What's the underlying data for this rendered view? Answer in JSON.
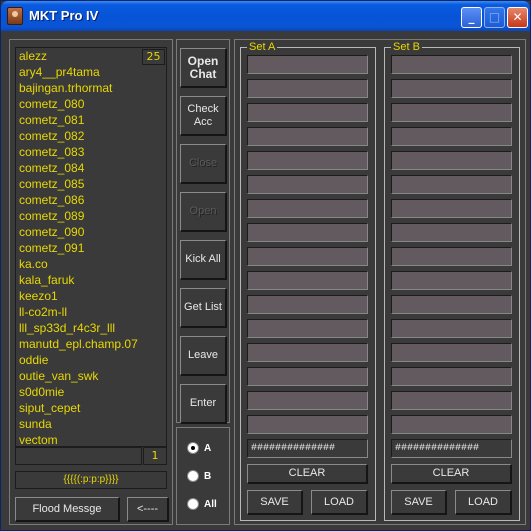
{
  "window": {
    "title": "MKT Pro IV",
    "controls": {
      "minimize": "_",
      "maximize": "□",
      "close": "✕"
    }
  },
  "users": {
    "count": "25",
    "items": [
      "alezz",
      "ary4__pr4tama",
      "bajingan.trhormat",
      "cometz_080",
      "cometz_081",
      "cometz_082",
      "cometz_083",
      "cometz_084",
      "cometz_085",
      "cometz_086",
      "cometz_089",
      "cometz_090",
      "cometz_091",
      "ka.co",
      "kala_faruk",
      "keezo1",
      "ll-co2m-ll",
      "lll_sp33d_r4c3r_lll",
      "manutd_epl.champ.07",
      "oddie",
      "outie_van_swk",
      "s0d0mie",
      "siput_cepet",
      "sunda",
      "vectom"
    ],
    "scroll_count": "1",
    "message": "{{{{(:p:p:p}}}}"
  },
  "buttons": {
    "flood": "Flood Messge",
    "back": "<----",
    "open_chat": "Open Chat",
    "check_acc": "Check Acc",
    "close": "Close",
    "open": "Open",
    "kick_all": "Kick All",
    "get_list": "Get List",
    "leave": "Leave",
    "enter": "Enter"
  },
  "radio": {
    "options": [
      "A",
      "B",
      "All"
    ],
    "selected": "A"
  },
  "set_a": {
    "label": "Set A",
    "hash": "##############",
    "clear": "CLEAR",
    "save": "SAVE",
    "load": "LOAD"
  },
  "set_b": {
    "label": "Set B",
    "hash": "##############",
    "clear": "CLEAR",
    "save": "SAVE",
    "load": "LOAD"
  }
}
